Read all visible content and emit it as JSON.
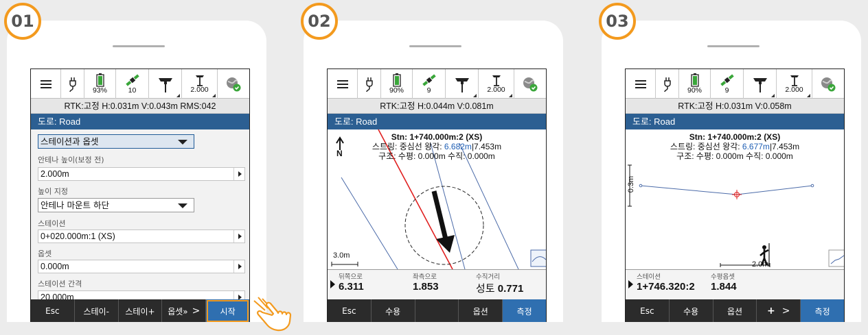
{
  "colors": {
    "accent": "#f39a1e",
    "titlebar": "#2c5f92",
    "softkey_primary": "#2f6fb0",
    "softkey_bg": "#2b2b2b",
    "line_red": "#e01f1f",
    "line_blue": "#4a6aa8"
  },
  "step1": {
    "badge": "01",
    "status": {
      "battery": "93%",
      "satellites": "10",
      "antenna_height": "2.000"
    },
    "rtk": "RTK:고정 H:0.031m V:0.043m RMS:042",
    "title": "도로: Road",
    "method_select": "스테이션과 옵셋",
    "antenna_height_label": "안테나 높이(보정 전)",
    "antenna_height_value": "2.000m",
    "measure_to_label": "높이 지정",
    "measure_to_value": "안테나 마운트 하단",
    "station_label": "스테이션",
    "station_value": "0+020.000m:1 (XS)",
    "offset_label": "옵셋",
    "offset_value": "0.000m",
    "interval_label": "스테이션 간격",
    "interval_value": "20.000m",
    "softkeys": [
      "Esc",
      "스테이-",
      "스테이+",
      "옵셋»",
      "시작"
    ],
    "softkey_more": ">"
  },
  "step2": {
    "badge": "02",
    "status": {
      "battery": "90%",
      "satellites": "9",
      "antenna_height": "2.000"
    },
    "rtk": "RTK:고정 H:0.044m V:0.081m",
    "title": "도로: Road",
    "info_line1": "Stn: 1+740.000m:2 (XS)",
    "info_line2_prefix": "스트링: 중심선 왕각: ",
    "info_line2_blue": "6.682m",
    "info_line2_suffix": "|7.453m",
    "info_line3": "구조: 수평: 0.000m 수직: 0.000m",
    "north_label": "N",
    "scale_label": "3.0m",
    "bottom": [
      {
        "label": "뒤쪽으로",
        "value": "6.311"
      },
      {
        "label": "좌측으로",
        "value": "1.853"
      },
      {
        "label": "수직거리",
        "value_prefix": "성토 ",
        "value": "0.771"
      }
    ],
    "softkeys": [
      "Esc",
      "수용",
      "",
      "옵션",
      "측정"
    ]
  },
  "step3": {
    "badge": "03",
    "status": {
      "battery": "90%",
      "satellites": "9",
      "antenna_height": "2.000"
    },
    "rtk": "RTK:고정 H:0.031m V:0.058m",
    "title": "도로: Road",
    "info_line1": "Stn: 1+740.000m:2 (XS)",
    "info_line2_prefix": "스트링: 중심선 왕각: ",
    "info_line2_blue": "6.677m",
    "info_line2_suffix": "|7.453m",
    "info_line3": "구조: 수평: 0.000m 수직: 0.000m",
    "vscale_label": "0.3m",
    "hscale_label": "2.0m",
    "bottom": [
      {
        "label": "스테이션",
        "value": "1+746.320:2"
      },
      {
        "label": "수평옵셋",
        "value": "1.844"
      }
    ],
    "softkeys": [
      "Esc",
      "수용",
      "옵션",
      "+",
      "측정"
    ],
    "softkey_more": ">"
  }
}
